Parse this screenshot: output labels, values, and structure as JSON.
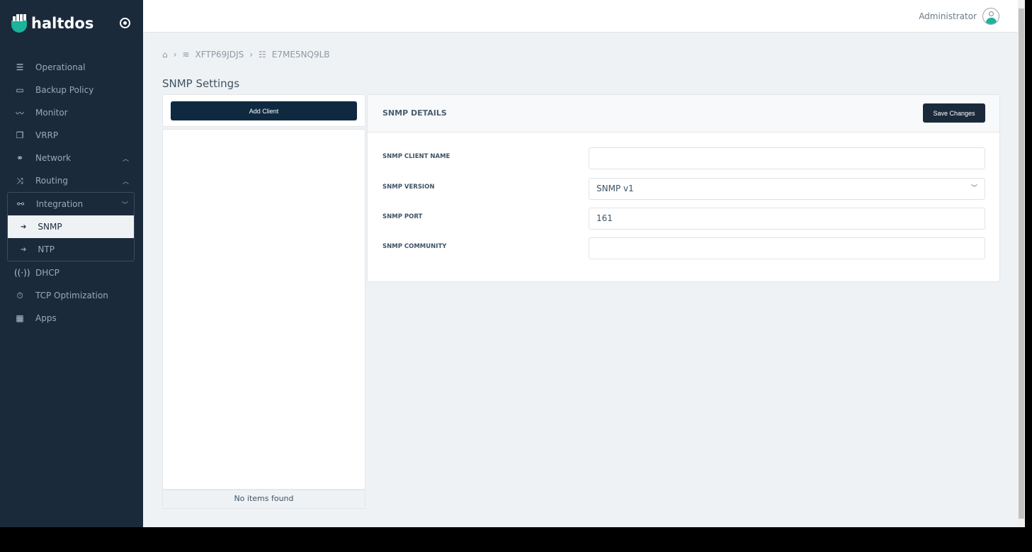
{
  "brand": {
    "name": "haltdos",
    "accent": "#1bb39a"
  },
  "sidebar": {
    "items": [
      {
        "label": "Operational",
        "icon": "sliders-icon"
      },
      {
        "label": "Backup Policy",
        "icon": "hard-drive-icon"
      },
      {
        "label": "Monitor",
        "icon": "activity-icon"
      },
      {
        "label": "VRRP",
        "icon": "copy-icon"
      },
      {
        "label": "Network",
        "icon": "network-icon"
      },
      {
        "label": "Routing",
        "icon": "shuffle-icon"
      },
      {
        "label": "Integration",
        "icon": "link-icon"
      },
      {
        "label": "DHCP",
        "icon": "broadcast-icon"
      },
      {
        "label": "TCP Optimization",
        "icon": "stopwatch-icon"
      },
      {
        "label": "Apps",
        "icon": "grid-icon"
      }
    ],
    "subitems": [
      {
        "label": "SNMP",
        "active": true
      },
      {
        "label": "NTP",
        "active": false
      }
    ]
  },
  "header": {
    "user": "Administrator"
  },
  "breadcrumb": [
    "XFTP69JDJS",
    "E7ME5NQ9LB"
  ],
  "page": {
    "title": "SNMP Settings",
    "add_client": "Add Client",
    "empty": "No items found"
  },
  "details": {
    "title": "SNMP DETAILS",
    "save": "Save Changes",
    "fields": [
      {
        "label": "SNMP CLIENT NAME",
        "value": ""
      },
      {
        "label": "SNMP VERSION",
        "value": "SNMP v1"
      },
      {
        "label": "SNMP PORT",
        "value": "161"
      },
      {
        "label": "SNMP COMMUNITY",
        "value": ""
      }
    ]
  }
}
